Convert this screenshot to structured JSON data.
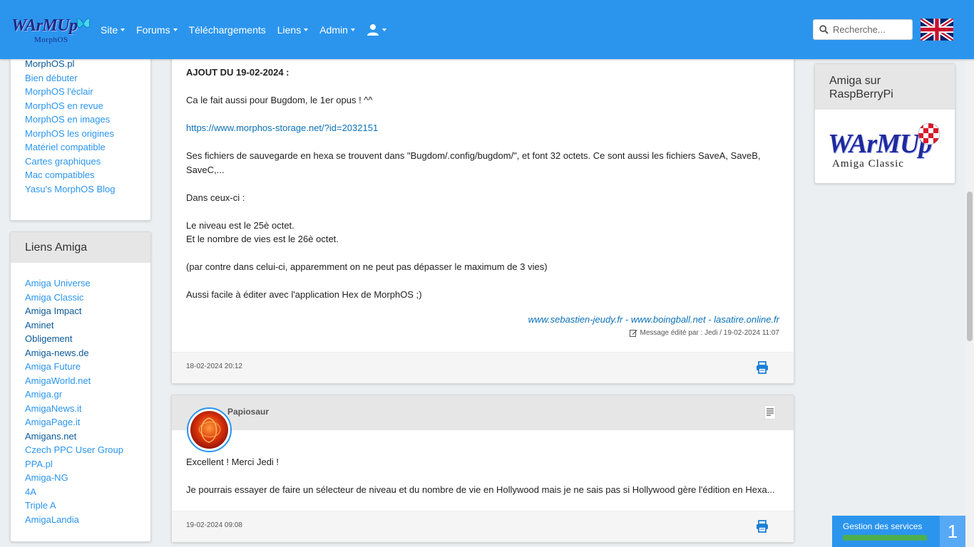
{
  "navbar": {
    "logo_text": "WArMUp",
    "logo_sub": "MorphOS",
    "menu": [
      {
        "label": "Site",
        "dropdown": true
      },
      {
        "label": "Forums",
        "dropdown": true
      },
      {
        "label": "Téléchargements",
        "dropdown": false
      },
      {
        "label": "Liens",
        "dropdown": true
      },
      {
        "label": "Admin",
        "dropdown": true
      }
    ],
    "user_icon": "user-icon",
    "search_placeholder": "Recherche...",
    "flag": "uk-flag-icon",
    "accent": "#2b95ee"
  },
  "left_sidebar": {
    "morphos_links": [
      "MorphOS.pl",
      "Bien débuter",
      "MorphOS l'éclair",
      "MorphOS en revue",
      "MorphOS en images",
      "MorphOS les origines",
      "Matériel compatible",
      "Cartes graphiques",
      "Mac compatibles",
      "Yasu's MorphOS Blog"
    ],
    "amiga_title": "Liens Amiga",
    "amiga_links": [
      "Amiga Universe",
      "Amiga Classic",
      "Amiga Impact",
      "Aminet",
      "Obligement",
      "Amiga-news.de",
      "Amiga Future",
      "AmigaWorld.net",
      "Amiga.gr",
      "AmigaNews.it",
      "AmigaPage.it",
      "Amigans.net",
      "Czech PPC User Group",
      "PPA.pl",
      "Amiga-NG",
      "4A",
      "Triple A",
      "AmigaLandia"
    ]
  },
  "post1": {
    "heading": "AJOUT DU 19-02-2024 :",
    "line1": "Ca le fait aussi pour Bugdom, le 1er opus ! ^^",
    "link": "https://www.morphos-storage.net/?id=2032151",
    "line2a": "Ses fichiers de sauvegarde en hexa se trouvent dans \"Bugdom/.config/bugdom/\", et font 32 octets. Ce sont aussi les fichiers SaveA, SaveB,",
    "line2b": "SaveC,...",
    "line3": "Dans ceux-ci :",
    "line4": "Le niveau est le 25è octet.",
    "line5": "Et le nombre de vies est le 26è octet.",
    "line6": "(par contre dans celui-ci, apparemment on ne peut pas dépasser le maximum de 3 vies)",
    "line7": "Aussi facile à éditer avec l'application Hex de MorphOS ;)",
    "sig_link1": "www.sebastien-jeudy.fr",
    "sig_sep1": " - ",
    "sig_link2": "www.boingball.net",
    "sig_sep2": " - ",
    "sig_link3": "lasatire.online.fr",
    "edited": "Message édité par : Jedi / 19-02-2024 11:07",
    "date": "18-02-2024 20:12"
  },
  "post2": {
    "author": "Papiosaur",
    "line1": "Excellent ! Merci Jedi !",
    "line2": "Je pourrais essayer de faire un sélecteur de niveau et du nombre de vie en Hollywood mais je ne sais pas si Hollywood gère l'édition en Hexa...",
    "date": "19-02-2024 09:08"
  },
  "right_card": {
    "title": "Amiga sur RaspBerryPi",
    "logo_text": "WArMUp",
    "logo_sub": "Amiga Classic"
  },
  "services": {
    "label": "Gestion des services",
    "count": "1",
    "bar_color": "#4caf50",
    "progress": 1.0
  }
}
